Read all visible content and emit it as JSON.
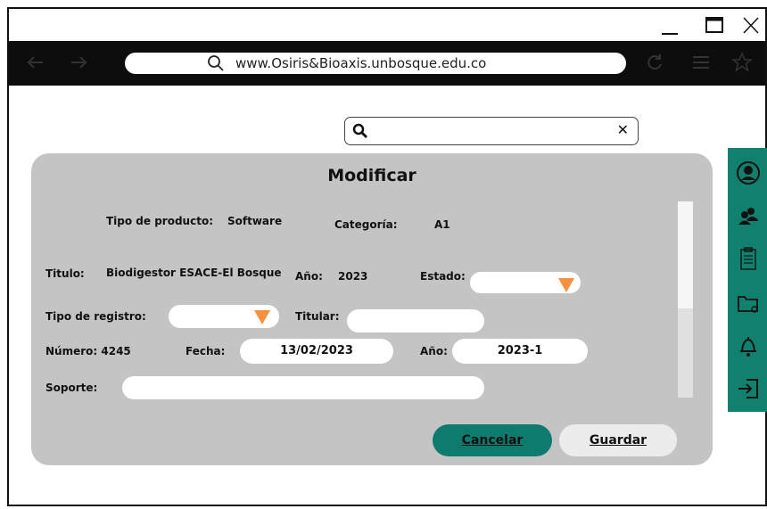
{
  "browser": {
    "url": "www.Osiris&Bioaxis.unbosque.edu.co",
    "window_controls": [
      "minimize-icon",
      "maximize-icon",
      "close-icon"
    ],
    "nav_icons": [
      "back-arrow-icon",
      "forward-arrow-icon",
      "reload-icon",
      "menu-icon",
      "star-icon"
    ]
  },
  "search": {
    "placeholder": "",
    "value": ""
  },
  "form": {
    "title": "Modificar",
    "tipo_producto_label": "Tipo de producto:",
    "tipo_producto_value": "Software",
    "categoria_label": "Categoría:",
    "categoria_value": "A1",
    "titulo_label": "Titulo:",
    "titulo_value": "Biodigestor ESACE-El Bosque",
    "anio_label": "Año:",
    "anio_value": "2023",
    "estado_label": "Estado:",
    "estado_value": "",
    "tipo_registro_label": "Tipo de registro:",
    "tipo_registro_value": "",
    "titular_label": "Titular:",
    "titular_value": "",
    "numero_label": "Número: 4245",
    "fecha_label": "Fecha:",
    "fecha_value": "13/02/2023",
    "anio2_label": "Año:",
    "anio2_value": "2023-1",
    "soporte_label": "Soporte:",
    "soporte_value": "",
    "cancel_label": "Cancelar",
    "save_label": "Guardar"
  },
  "sidebar": {
    "icons": [
      "user-icon",
      "users-icon",
      "clipboard-icon",
      "folder-icon",
      "bell-icon",
      "logout-icon"
    ]
  },
  "colors": {
    "accent": "#12806f",
    "cancel_button": "#0f7a6e",
    "dropdown_arrow": "#f5913e",
    "panel": "#c4c4c4"
  }
}
